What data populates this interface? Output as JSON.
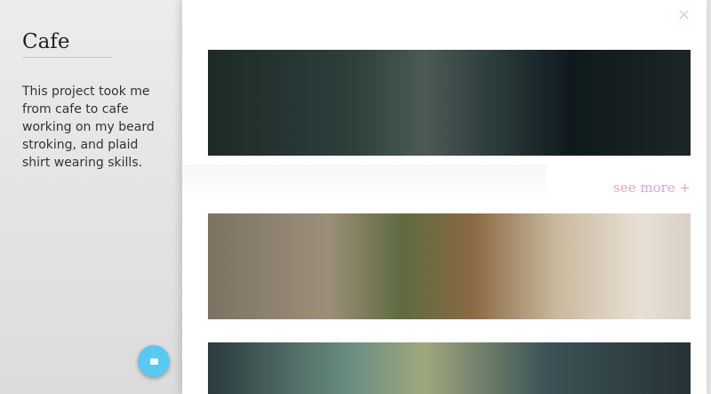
{
  "sidebar": {
    "title": "Cafe",
    "description": "This project took me from cafe to cafe working on my beard stroking, and plaid shirt wearing skills."
  },
  "panel": {
    "close_icon": "×",
    "see_more": "see more +"
  },
  "colors": {
    "fab": "#5ac8f0",
    "see_more": "#d7a8cf",
    "close": "#b9dcef"
  },
  "icons": [
    "close-icon",
    "mail-icon"
  ]
}
